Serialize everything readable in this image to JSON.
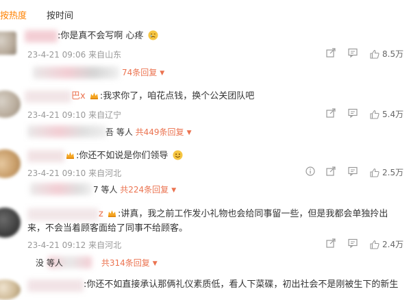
{
  "tabs": [
    {
      "label": "按热度"
    },
    {
      "label": "按时间"
    }
  ],
  "colors": {
    "accent": "#ff8200",
    "reply": "#eb7350",
    "meta": "#999999"
  },
  "comments": [
    {
      "name_visible": "",
      "text": ":你是真不会写啊 心疼",
      "has_emoji": true,
      "date": "23-4-21 09:06",
      "location": "来自山东",
      "replies_people": "",
      "replies_label": "74条回复",
      "likes": "8.5万"
    },
    {
      "name_visible": "巴x",
      "text": ":我求你了，咱花点钱，换个公关团队吧",
      "has_emoji": false,
      "date": "23-4-21 09:10",
      "location": "来自辽宁",
      "replies_people": "吾 等人",
      "replies_label": "共449条回复",
      "likes": "5.4万"
    },
    {
      "name_visible": "",
      "text": ":你还不如说是你们领导",
      "has_emoji": true,
      "date": "23-4-21 09:10",
      "location": "来自河北",
      "replies_people": "7 等人",
      "replies_label": "共224条回复",
      "likes": "2.5万"
    },
    {
      "name_visible": "z",
      "text_line1": ":讲真，我之前工作发小礼物也会给同事留一些，但是我都会单独拎出",
      "text_line2": "来，不会当着顾客面给了同事不给顾客。",
      "date": "23-4-21 09:12",
      "location": "来自河北",
      "replies_people": "没 等人",
      "replies_label": "共314条回复",
      "likes": "2.4万"
    },
    {
      "name_visible": "",
      "text": ":你还不如直接承认那俩礼仪素质低，看人下菜碟，初出社会不是刚被生下的新生"
    }
  ]
}
